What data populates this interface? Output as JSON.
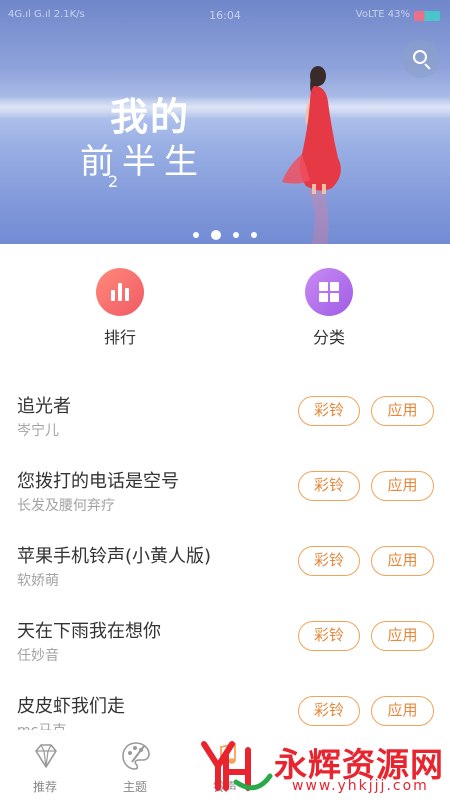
{
  "status_bar": {
    "left": "4G.ıl  G.ıl  2.1K/s",
    "time": "16:04",
    "right": "VoLTE  43%"
  },
  "banner": {
    "title_line1": "我的",
    "title_line2": "前半生",
    "title_half": "2",
    "slides": 4,
    "active_slide": 1,
    "colors": {
      "dress": "#e63946",
      "sky": "#8ea3db"
    }
  },
  "categories": [
    {
      "label": "排行",
      "icon": "bar-chart-icon",
      "color": "#f05a64"
    },
    {
      "label": "分类",
      "icon": "grid-icon",
      "color": "#9f5be6"
    }
  ],
  "songs": [
    {
      "title": "追光者",
      "artist": "岑宁儿"
    },
    {
      "title": "您拨打的电话是空号",
      "artist": "长发及腰何弃疗"
    },
    {
      "title": "苹果手机铃声(小黄人版)",
      "artist": "软娇萌"
    },
    {
      "title": "天在下雨我在想你",
      "artist": "任妙音"
    },
    {
      "title": "皮皮虾我们走",
      "artist": "mc马克"
    }
  ],
  "actions": {
    "ring_label": "彩铃",
    "apply_label": "应用",
    "accent": "#f0a45c"
  },
  "bottom_nav": [
    {
      "label": "推荐",
      "icon": "diamond-icon"
    },
    {
      "label": "主题",
      "icon": "palette-icon"
    },
    {
      "label": "铃声",
      "icon": "music-note-icon"
    }
  ],
  "watermark": {
    "text": "永辉资源网",
    "url": "www.yhkjjj.com",
    "color": "#e8242f"
  }
}
